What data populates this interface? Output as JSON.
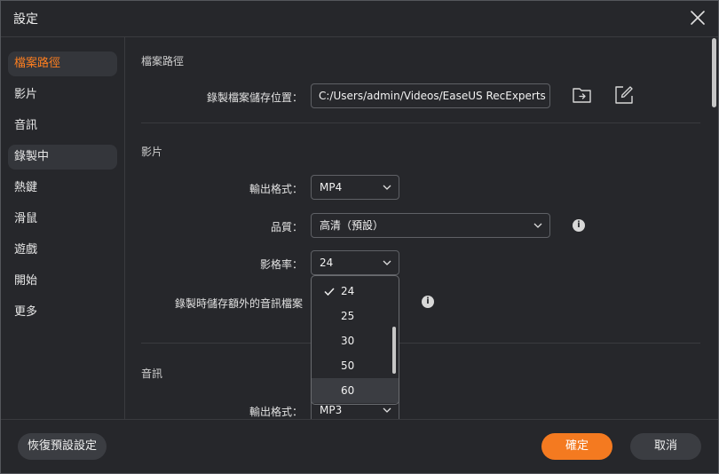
{
  "window": {
    "title": "設定"
  },
  "sidebar": {
    "items": [
      {
        "label": "檔案路徑"
      },
      {
        "label": "影片"
      },
      {
        "label": "音訊"
      },
      {
        "label": "錄製中"
      },
      {
        "label": "熱鍵"
      },
      {
        "label": "滑鼠"
      },
      {
        "label": "遊戲"
      },
      {
        "label": "開始"
      },
      {
        "label": "更多"
      }
    ]
  },
  "file_path": {
    "section_title": "檔案路徑",
    "save_location_label": "錄製檔案儲存位置：",
    "save_location_value": "C:/Users/admin/Videos/EaseUS RecExperts"
  },
  "video": {
    "section_title": "影片",
    "output_format_label": "輸出格式：",
    "output_format_value": "MP4",
    "quality_label": "品質：",
    "quality_value": "高清（預設）",
    "frame_rate_label": "影格率：",
    "frame_rate_value": "24",
    "extra_audio_label": "錄製時儲存額外的音訊檔案",
    "frame_rate_options": [
      "24",
      "25",
      "30",
      "50",
      "60"
    ]
  },
  "audio": {
    "section_title": "音訊",
    "output_format_label": "輸出格式：",
    "output_format_value": "MP3"
  },
  "footer": {
    "reset_label": "恢復預設設定",
    "ok_label": "確定",
    "cancel_label": "取消"
  },
  "colors": {
    "accent": "#f47a20",
    "active_text": "#ff7f1f",
    "background": "#26272b"
  }
}
